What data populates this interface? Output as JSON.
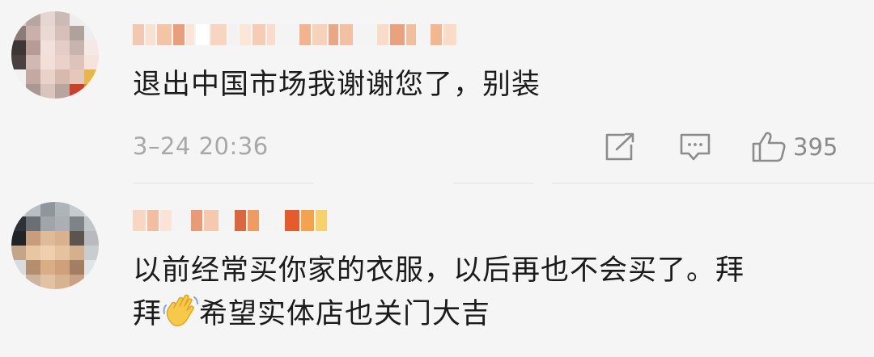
{
  "comments": [
    {
      "text": "退出中国市场我谢谢您了，别装",
      "time": "3–24 20:36",
      "likes": "395",
      "avatar_colors": [
        "#d8cbc6",
        "#b5a6a2",
        "#e6d5d0",
        "#cbbab5",
        "#eee",
        "#f2f2f2",
        "#8a7a78",
        "#c9b0a9",
        "#e9d9d3",
        "#d7c0ba",
        "#b0a19d",
        "#eee",
        "#3d3536",
        "#b79b94",
        "#f0e1dc",
        "#e3cdc6",
        "#c7b4ae",
        "#f5e9e5",
        "#4a4040",
        "#d1b8b0",
        "#f3dfd8",
        "#ead2ca",
        "#dcc4bc",
        "#f5e3dc",
        "#f1f1f1",
        "#c3a9a1",
        "#e8d2ca",
        "#d8b9ad",
        "#e5c7bb",
        "#e8b64a",
        "#f1f1f1",
        "#a89893",
        "#d9c5be",
        "#b9a49e",
        "#c9412a",
        "#e08b2a"
      ],
      "name_colors": [
        "#f2c9b0",
        "#f9e1cf",
        "#f4c4a6",
        "#e8a07c",
        "#fbe5d6",
        "#fff",
        "#f8d5c0",
        "#f2f2f2",
        "#fbe6d7",
        "#f5cdb5",
        "#f9dccb",
        "#f4f4f4",
        "#f1b48e",
        "#f7d2ba",
        "#e9a783",
        "#f2c1a3",
        "#f4f4f4",
        "#f8dcc8",
        "#e8a27e",
        "#f0bf9e",
        "#f4f4f4",
        "#f1b78f",
        "#f8dcc7"
      ]
    },
    {
      "text_line1": "以前经常买你家的衣服，以后再也不会买了。拜",
      "text_line2_a": "拜",
      "text_line2_b": "希望实体店也关门大吉",
      "avatar_colors": [
        "#cfd3d6",
        "#b8bec2",
        "#8e969c",
        "#aeb4b8",
        "#c7ccd0",
        "#dfe2e4",
        "#2e3236",
        "#6a6f73",
        "#9fa5a9",
        "#aab0b4",
        "#7d8387",
        "#c2c6c9",
        "#212427",
        "#c79d7e",
        "#e0bb99",
        "#d9b18f",
        "#5c554f",
        "#b7bbbe",
        "#c4a58a",
        "#e8c6a4",
        "#efcfae",
        "#e6c3a0",
        "#d6b08c",
        "#c9cdd0",
        "#d8dcdf",
        "#b58e70",
        "#d9ad86",
        "#cfa17a",
        "#a37e62",
        "#e2e5e7",
        "#eceeef",
        "#cdb49e",
        "#e1c3a4",
        "#d8b391",
        "#c8a283",
        "#eef0f1"
      ],
      "name_colors": [
        "#f7d6c2",
        "#f2bda0",
        "#fbe4d6",
        "#f4f4f4",
        "#e99a77",
        "#f5c9ad",
        "#f4f4f4",
        "#d9683e",
        "#ef9c63",
        "#f4f4f4",
        "#f4f4f4",
        "#e65b2c",
        "#f2a34c",
        "#f7d16c"
      ]
    }
  ]
}
